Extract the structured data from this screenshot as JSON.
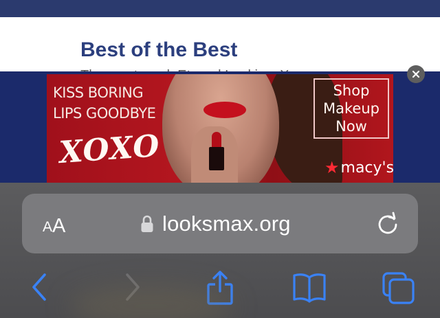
{
  "page": {
    "heading": "Best of the Best",
    "subtext": "The most-read, Eternal Lookism X"
  },
  "ad": {
    "headline_lines": [
      "KISS BORING",
      "LIPS GOODBYE"
    ],
    "logo_text": "XOXO",
    "cta_lines": [
      "Shop",
      "Makeup",
      "Now"
    ],
    "brand_star": "★",
    "brand": "macy's"
  },
  "safari": {
    "text_size_small": "A",
    "text_size_big": "A",
    "url": "looksmax.org",
    "accent_color": "#3a82f6",
    "disabled_color": "#6f6f72"
  },
  "icons": {
    "close": "close-icon",
    "lock": "lock-icon",
    "reload": "reload-icon",
    "back": "chevron-left-icon",
    "forward": "chevron-right-icon",
    "share": "share-icon",
    "bookmarks": "book-icon",
    "tabs": "tabs-icon"
  }
}
